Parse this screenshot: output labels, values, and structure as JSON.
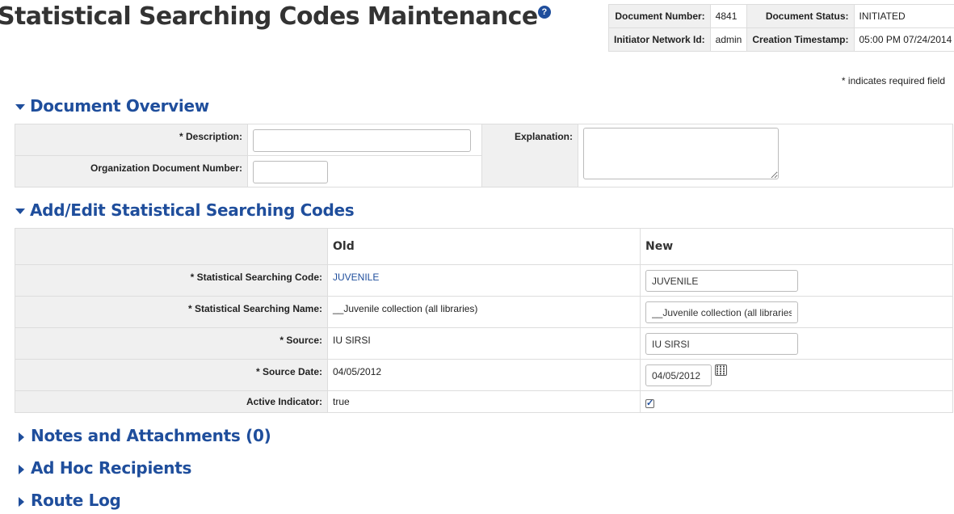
{
  "page": {
    "title": "Statistical Searching Codes Maintenance",
    "help_glyph": "?"
  },
  "docinfo": {
    "doc_number_label": "Document Number:",
    "doc_number": "4841",
    "doc_status_label": "Document Status:",
    "doc_status": "INITIATED",
    "initiator_label": "Initiator Network Id:",
    "initiator": "admin",
    "created_label": "Creation Timestamp:",
    "created": "05:00 PM 07/24/2014"
  },
  "required_note": "* indicates required field",
  "overview": {
    "heading": "Document Overview",
    "description_label": "* Description:",
    "description_value": "",
    "org_doc_label": "Organization Document Number:",
    "org_doc_value": "",
    "explanation_label": "Explanation:",
    "explanation_value": ""
  },
  "edit": {
    "heading": "Add/Edit Statistical Searching Codes",
    "old_header": "Old",
    "new_header": "New",
    "code_label": "* Statistical Searching Code:",
    "code_old": "JUVENILE",
    "code_new": "JUVENILE",
    "name_label": "* Statistical Searching Name:",
    "name_old": "__Juvenile collection (all libraries)",
    "name_new": "__Juvenile collection (all libraries)",
    "source_label": "* Source:",
    "source_old": "IU SIRSI",
    "source_new": "IU SIRSI",
    "date_label": "* Source Date:",
    "date_old": "04/05/2012",
    "date_new": "04/05/2012",
    "active_label": "Active Indicator:",
    "active_old": "true",
    "active_new_checked": true,
    "check_glyph": "✓"
  },
  "collapsed_sections": {
    "notes": "Notes and Attachments (0)",
    "adhoc": "Ad Hoc Recipients",
    "routelog": "Route Log"
  },
  "colors": {
    "accent": "#1f4e9c",
    "label_bg": "#f0f0f0",
    "border": "#dddddd"
  }
}
